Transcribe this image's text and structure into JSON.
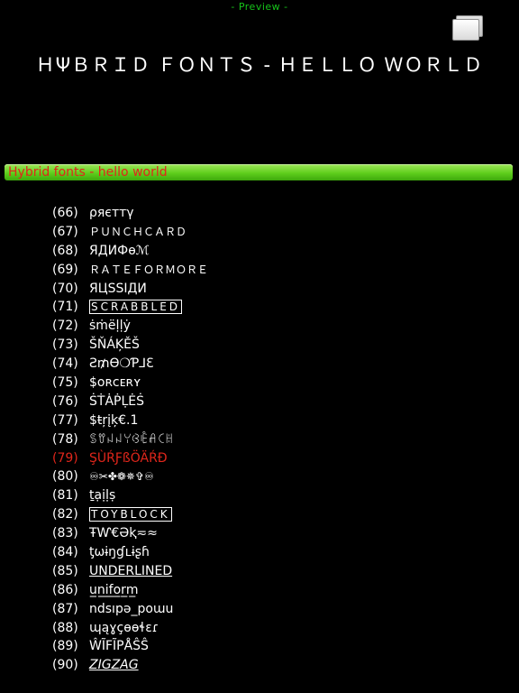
{
  "header": {
    "preview_label": "- Preview -",
    "title": "ＨΨＢＲＩＤ ＦＯＮＴＳ - ＨＥＬＬＯ ＷＯＲＬＤ",
    "copy_icon": "copy-icon"
  },
  "banner": {
    "text": "Hybrid fonts - hello world"
  },
  "fonts": [
    {
      "number": "(66)",
      "name": "ρяєттγ"
    },
    {
      "number": "(67)",
      "name": "ＰＵＮＣＨＣＡＲＤ"
    },
    {
      "number": "(68)",
      "name": "ЯДИФѳℳ"
    },
    {
      "number": "(69)",
      "name": "ＲＡＴＥＦＯＲＭＯＲＥ"
    },
    {
      "number": "(70)",
      "name": "ЯЦSSIДИ"
    },
    {
      "number": "(71)",
      "name": "SCRABBLED"
    },
    {
      "number": "(72)",
      "name": "ṡṁëḷḷẏ"
    },
    {
      "number": "(73)",
      "name": "ŠŇÁĶĚŠ"
    },
    {
      "number": "(74)",
      "name": "Ƨ₥Ɵ❍Ƥ⅃Ɛ"
    },
    {
      "number": "(75)",
      "name": "$ᴏʀᴄᴇʀʏ"
    },
    {
      "number": "(76)",
      "name": "ṠṪȦṖḶĖṠ"
    },
    {
      "number": "(77)",
      "name": "$ŧŗįķ€.1"
    },
    {
      "number": "(78)",
      "name": "ꌚꀎꈤꈤꌩꃳꍟꋬꉔꀍ"
    },
    {
      "number": "(79)",
      "name": "ŞÙŔƑßÖÄŔÐ"
    },
    {
      "number": "(80)",
      "name": "♾✂✤❁✵✞♾"
    },
    {
      "number": "(81)",
      "name": "ṯạịḷṣ"
    },
    {
      "number": "(82)",
      "name": "TOYBLOCK"
    },
    {
      "number": "(83)",
      "name": "ŦⱲ€Əⱪ≂≈"
    },
    {
      "number": "(84)",
      "name": "ƫωɨŋɠʟɨʂɦ"
    },
    {
      "number": "(85)",
      "name": "UNDERLINED"
    },
    {
      "number": "(86)",
      "name": "u̲n̲i̲f̲o̲r̲m̲"
    },
    {
      "number": "(87)",
      "name": "ndsıpǝ_poɯu"
    },
    {
      "number": "(88)",
      "name": "ɰąɣçɵɵɬɛɾ"
    },
    {
      "number": "(89)",
      "name": "ŴĨFĨPÅŜŜ"
    },
    {
      "number": "(90)",
      "name": "ZIGZAG"
    }
  ],
  "selected_index": 13,
  "colors": {
    "background": "#000000",
    "preview_label": "#16c31a",
    "banner_green": "#5fce1c",
    "accent_red": "#e0261b",
    "text": "#ffffff"
  }
}
